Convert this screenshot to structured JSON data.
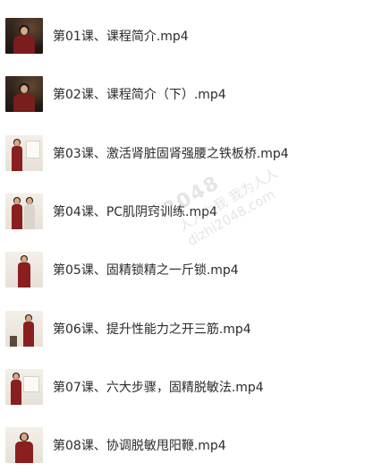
{
  "lessons": [
    {
      "title": "第01课、课程简介.mp4",
      "thumb": "dark"
    },
    {
      "title": "第02课、课程简介（下）.mp4",
      "thumb": "dark"
    },
    {
      "title": "第03课、激活肾脏固肾强腰之铁板桥.mp4",
      "thumb": "light"
    },
    {
      "title": "第04课、PC肌阴窍训练.mp4",
      "thumb": "light"
    },
    {
      "title": "第05课、固精锁精之一斤锁.mp4",
      "thumb": "light"
    },
    {
      "title": "第06课、提升性能力之开三筋.mp4",
      "thumb": "light"
    },
    {
      "title": "第07课、六大步骤，固精脱敏法.mp4",
      "thumb": "light"
    },
    {
      "title": "第08课、协调脱敏甩阳鞭.mp4",
      "thumb": "light"
    }
  ],
  "watermark": {
    "number": "2048",
    "line1": "人人为我 我为人人",
    "line2": "dizhi2048.com"
  }
}
